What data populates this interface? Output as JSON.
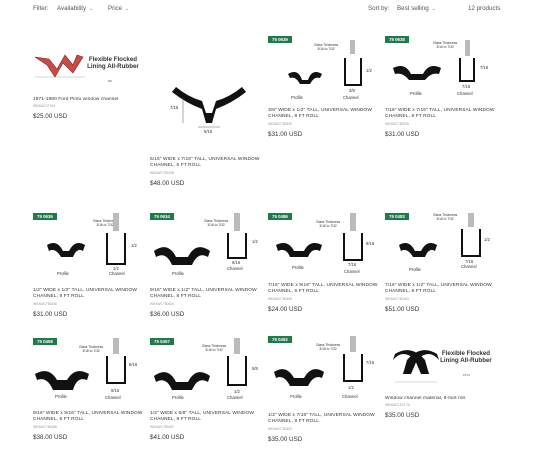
{
  "filter": {
    "label": "Filter:",
    "availability": "Availability",
    "price": "Price"
  },
  "sort": {
    "label": "Sort by:",
    "selected": "Best selling"
  },
  "product_count": "12 products",
  "products": [
    {
      "title": "1971-1980 Ford Pinto window channel",
      "sku": "WEAWC4T194",
      "price": "$25.00 USD",
      "illustration_text": "Flexible Flocked Lining All-Rubber",
      "part_number": "9R"
    },
    {
      "title": "5/16\" WIDE x 7/16\" TALL, UNIVERSAL WINDOW CHANNEL, 5 FT ROLL",
      "sku": "WEAWC75S005",
      "price": "$48.00 USD",
      "height_label": "7/16",
      "width_label": "5/16"
    },
    {
      "badge": "75 0639",
      "title": "3/8\" WIDE x 1/2\" TALL, UNIVERSAL WINDOW CHANNEL, 8 FT ROLL",
      "sku": "WEAWC750639",
      "price": "$31.00 USD",
      "glass_text": "Glass Thickness",
      "glass_range": "3/16 to 7/32",
      "height_label": "1/2",
      "width_label": "3/8",
      "profile_label": "Profile",
      "channel_label": "Channel"
    },
    {
      "badge": "75 0638",
      "title": "7/16\" WIDE x 7/16\" TALL, UNIVERSAL WINDOW CHANNEL, 8 FT ROLL",
      "sku": "WEAWC750638",
      "price": "$31.00 USD",
      "glass_text": "Glass Thickness",
      "glass_range": "3/16 to 7/32",
      "height_label": "7/16",
      "width_label": "7/16",
      "profile_label": "Profile",
      "channel_label": "Channel"
    },
    {
      "badge": "75 0636",
      "title": "1/2\" WIDE x 1/2\" TALL, UNIVERSAL WINDOW CHANNEL, 8 FT ROLL",
      "sku": "WEAWC750636",
      "price": "$31.00 USD",
      "glass_text": "Glass Thickness",
      "glass_range": "3/16 to 7/32",
      "height_label": "1/2",
      "width_label": "1/2",
      "profile_label": "Profile",
      "channel_label": "Channel"
    },
    {
      "badge": "75 0634",
      "title": "9/16\" WIDE x 1/2\" TALL, UNIVERSAL WINDOW CHANNEL, 8 FT ROLL",
      "sku": "WEAWC750634",
      "price": "$36.00 USD",
      "glass_text": "Glass Thickness",
      "glass_range": "3/16 to 7/32",
      "height_label": "1/2",
      "width_label": "9/16",
      "profile_label": "Profile",
      "channel_label": "Channel"
    },
    {
      "badge": "75 0486",
      "title": "7/16\" WIDE x 9/16\" TALL, UNIVERSAL WINDOW CHANNEL, 6 FT ROLL",
      "sku": "WEAWC750486",
      "price": "$24.00 USD",
      "glass_text": "Glass Thickness",
      "glass_range": "3/16 to 7/32",
      "height_label": "9/16",
      "width_label": "7/16",
      "profile_label": "Profile",
      "channel_label": "Channel"
    },
    {
      "badge": "75 0483",
      "title": "7/16\" WIDE x 1/2\" TALL, UNIVERSAL WINDOW CHANNEL, 8 FT ROLL",
      "sku": "WEAWC750483",
      "price": "$51.00 USD",
      "glass_text": "Glass Thickness",
      "glass_range": "3/16 to 7/32",
      "height_label": "1/2",
      "width_label": "7/16",
      "profile_label": "Profile",
      "channel_label": "Channel"
    },
    {
      "badge": "75 0458",
      "title": "9/16\" WIDE x 9/16\" TALL, UNIVERSAL WINDOW CHANNEL, 6 FT ROLL",
      "sku": "WEAWC750458",
      "price": "$38.00 USD",
      "glass_text": "Glass Thickness",
      "glass_range": "3/16 to 7/32",
      "height_label": "9/16",
      "width_label": "9/16",
      "profile_label": "Profile",
      "channel_label": "Channel"
    },
    {
      "badge": "75 0457",
      "title": "1/2\" WIDE x 5/8\" TALL, UNIVERSAL WINDOW CHANNEL, 8 FT ROLL",
      "sku": "WEAWC750457",
      "price": "$41.00 USD",
      "glass_text": "Glass Thickness",
      "glass_range": "3/16 to 7/32",
      "height_label": "5/8",
      "width_label": "1/2",
      "profile_label": "Profile",
      "channel_label": "Channel"
    },
    {
      "badge": "75 0452",
      "title": "1/2\" WIDE x 7/16\" TALL, UNIVERSAL WINDOW CHANNEL, 8 FT ROLL",
      "sku": "WEAWC750452",
      "price": "$35.00 USD",
      "glass_text": "Glass Thickness",
      "glass_range": "3/16 to 7/32",
      "height_label": "7/16",
      "width_label": "1/2",
      "profile_label": "Profile",
      "channel_label": "Channel"
    },
    {
      "title": "Window channel material, 8-foot roll.",
      "sku": "WEAWC1574-76",
      "price": "$35.00 USD",
      "illustration_text": "Flexible Flocked Lining All-Rubber",
      "part_number": "1574"
    }
  ],
  "colors": {
    "badge": "#1f7a4c",
    "rubber": "#111111",
    "red_rubber": "#c94a46",
    "text": "#333333",
    "sku": "#999999"
  }
}
